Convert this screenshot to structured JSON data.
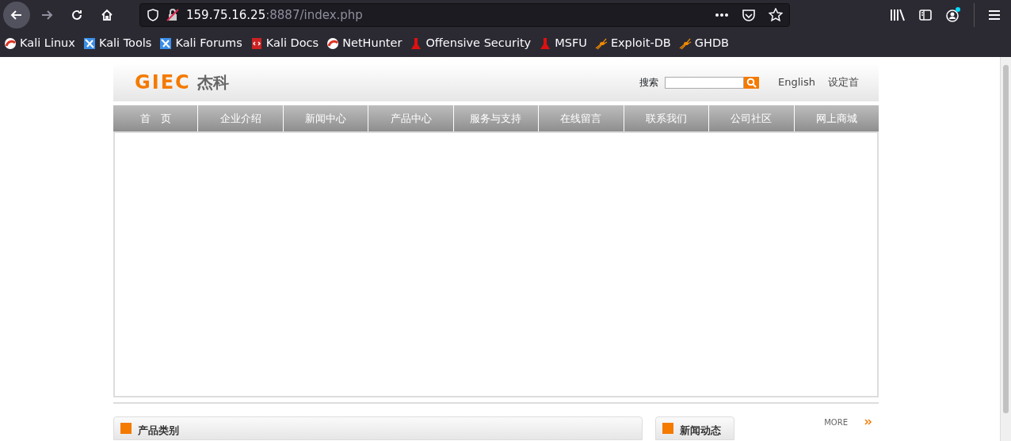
{
  "browser": {
    "url_host": "159.75.16.25",
    "url_rest": ":8887/index.php",
    "bookmarks": [
      {
        "label": "Kali Linux",
        "kind": "kali"
      },
      {
        "label": "Kali Tools",
        "kind": "tools"
      },
      {
        "label": "Kali Forums",
        "kind": "tools"
      },
      {
        "label": "Kali Docs",
        "kind": "docs"
      },
      {
        "label": "NetHunter",
        "kind": "kali"
      },
      {
        "label": "Offensive Security",
        "kind": "offsec"
      },
      {
        "label": "MSFU",
        "kind": "offsec"
      },
      {
        "label": "Exploit-DB",
        "kind": "spider"
      },
      {
        "label": "GHDB",
        "kind": "spider"
      }
    ]
  },
  "site": {
    "logo_text": "GIEC",
    "logo_cn": "杰科",
    "search_label": "搜索",
    "links": [
      "English",
      "设定首"
    ],
    "nav": [
      "首　页",
      "企业介绍",
      "新闻中心",
      "产品中心",
      "服务与支持",
      "在线留言",
      "联系我们",
      "公司社区",
      "网上商城"
    ],
    "sections": [
      {
        "title": "产品类别",
        "kind": "wide"
      },
      {
        "title": "新闻动态",
        "kind": "narrow"
      }
    ],
    "more": "MORE"
  }
}
